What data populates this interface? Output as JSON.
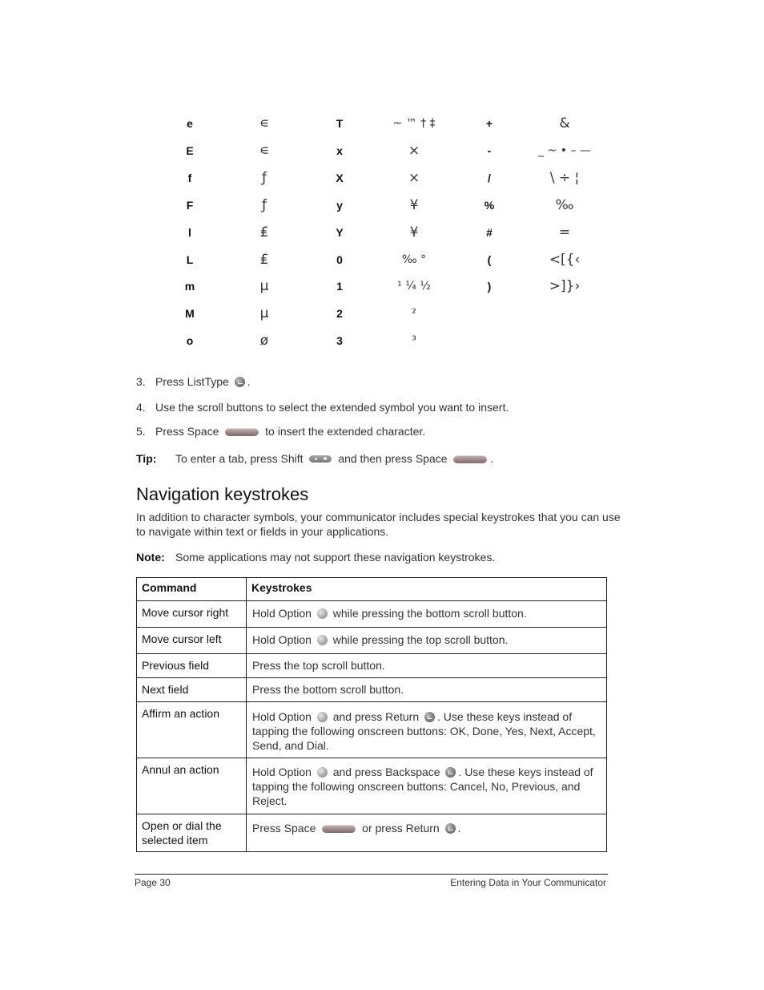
{
  "symbol_table": {
    "rows": [
      [
        "e",
        "∊",
        "T",
        "~ ™ † ‡",
        "+",
        "&"
      ],
      [
        "E",
        "∊",
        "x",
        "×",
        "-",
        "_ ~ • – —"
      ],
      [
        "f",
        "ƒ",
        "X",
        "×",
        "/",
        "\\ ÷ ¦"
      ],
      [
        "F",
        "ƒ",
        "y",
        "¥",
        "%",
        "‰"
      ],
      [
        "l",
        "₤",
        "Y",
        "¥",
        "#",
        "="
      ],
      [
        "L",
        "₤",
        "0",
        "‰ °",
        "(",
        "<[{‹"
      ],
      [
        "m",
        "µ",
        "1",
        "¹ ¼ ½",
        ")",
        ">]}›"
      ],
      [
        "M",
        "µ",
        "2",
        "²",
        "",
        ""
      ],
      [
        "o",
        "ø",
        "3",
        "³",
        "",
        ""
      ]
    ]
  },
  "steps": [
    {
      "num": "3.",
      "before": "Press ListType",
      "icon": "listtype-key-icon",
      "after": "."
    },
    {
      "num": "4.",
      "text": "Use the scroll buttons to select the extended symbol you want to insert."
    },
    {
      "num": "5.",
      "before": "Press Space",
      "icon": "space-key-icon",
      "after": "to insert the extended character."
    }
  ],
  "tip": {
    "label": "Tip:",
    "part1": "To enter a tab, press Shift",
    "part2": "and then press Space",
    "part3": "."
  },
  "section": {
    "title": "Navigation keystrokes",
    "intro_line1": "In addition to character symbols, your communicator includes special keystrokes that you can use",
    "intro_line2": "to navigate within text or fields in your applications.",
    "note_label": "Note:",
    "note_text": "Some applications may not support these navigation keystrokes."
  },
  "nav_table": {
    "headers": [
      "Command",
      "Keystrokes"
    ],
    "rows": [
      {
        "command": "Move cursor right",
        "k1": "Hold Option",
        "k2": "while pressing the bottom scroll button."
      },
      {
        "command": "Move cursor left",
        "k1": "Hold Option",
        "k2": "while pressing the top scroll button."
      },
      {
        "command": "Previous field",
        "k1": "Press the top scroll button."
      },
      {
        "command": "Next field",
        "k1": "Press the bottom scroll button."
      },
      {
        "command": "Affirm an action",
        "k1": "Hold Option",
        "k2": "and press Return",
        "k3": ". Use these keys instead of tapping the following onscreen buttons: OK, Done, Yes, Next, Accept, Send, and Dial."
      },
      {
        "command": "Annul an action",
        "k1": "Hold Option",
        "k2": "and press Backspace",
        "k3": ". Use these keys instead of tapping the following onscreen buttons: Cancel, No, Previous, and Reject."
      },
      {
        "command": "Open or dial the selected item",
        "k1": "Press Space",
        "k2": "or press Return",
        "k3": "."
      }
    ]
  },
  "footer": {
    "page": "Page 30",
    "chapter": "Entering Data in Your Communicator"
  }
}
